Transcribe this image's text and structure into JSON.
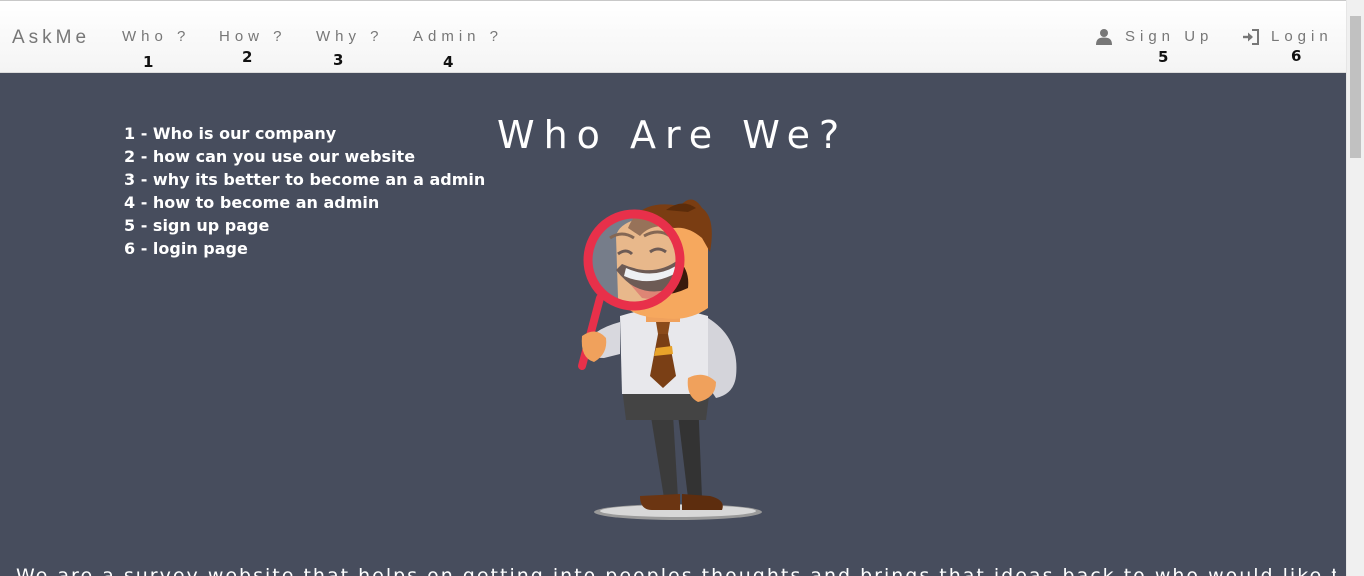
{
  "navbar": {
    "brand": "AskMe",
    "links": [
      {
        "label": "Who ?",
        "number": "1"
      },
      {
        "label": "How ?",
        "number": "2"
      },
      {
        "label": "Why ?",
        "number": "3"
      },
      {
        "label": "Admin ?",
        "number": "4"
      }
    ],
    "signup": {
      "label": "Sign Up",
      "number": "5",
      "icon": "user-icon"
    },
    "login": {
      "label": "Login",
      "number": "6",
      "icon": "login-icon"
    }
  },
  "legend": [
    "1 - Who is our company",
    "2 - how can you use our website",
    "3 - why its better to become an a admin",
    "4 - how to become an admin",
    "5 - sign up page",
    "6 - login page"
  ],
  "hero": {
    "title": "Who Are We?",
    "text": "We are a survey website that helps on getting into peoples thoughts and brings that ideas back to who would like to know",
    "illustration": "man-with-magnifying-glass"
  },
  "colors": {
    "navbar_bg": "#f8f8f8",
    "nav_text": "#777777",
    "hero_bg": "#474d5d",
    "hero_text": "#ffffff"
  }
}
